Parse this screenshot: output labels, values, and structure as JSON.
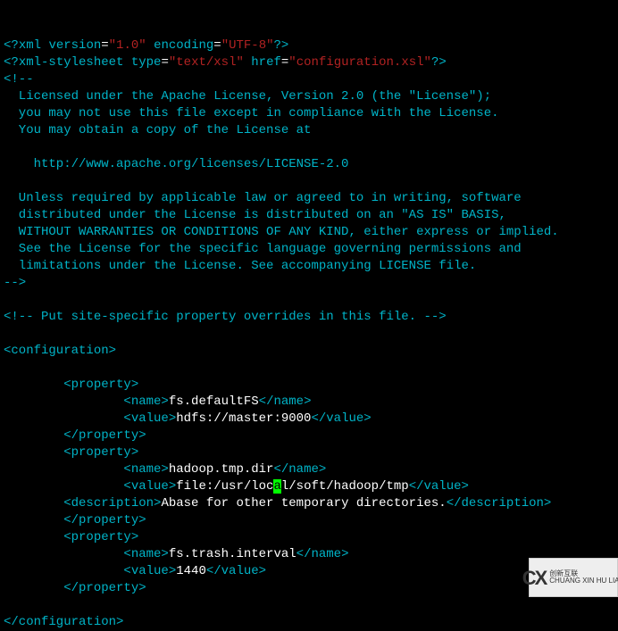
{
  "decl": {
    "pi": "xml",
    "vAttr": "version",
    "vVal": "\"1.0\"",
    "eAttr": "encoding",
    "eVal": "\"UTF-8\""
  },
  "ss": {
    "pi": "xml-stylesheet",
    "tAttr": "type",
    "tVal": "\"text/xsl\"",
    "hAttr": "href",
    "hVal": "\"configuration.xsl\""
  },
  "license": [
    "<!--",
    "  Licensed under the Apache License, Version 2.0 (the \"License\");",
    "  you may not use this file except in compliance with the License.",
    "  You may obtain a copy of the License at",
    "",
    "    http://www.apache.org/licenses/LICENSE-2.0",
    "",
    "  Unless required by applicable law or agreed to in writing, software",
    "  distributed under the License is distributed on an \"AS IS\" BASIS,",
    "  WITHOUT WARRANTIES OR CONDITIONS OF ANY KIND, either express or implied.",
    "  See the License for the specific language governing permissions and",
    "  limitations under the License. See accompanying LICENSE file.",
    "-->"
  ],
  "siteComment": "<!-- Put site-specific property overrides in this file. -->",
  "tags": {
    "confOpen": "<configuration>",
    "confClose": "</configuration>",
    "propOpen": "<property>",
    "propClose": "</property>",
    "nameOpen": "<name>",
    "nameClose": "</name>",
    "valueOpen": "<value>",
    "valueClose": "</value>",
    "descOpen": "<description>",
    "descClose": "</description>"
  },
  "p1": {
    "name": "fs.defaultFS",
    "value": "hdfs://master:9000"
  },
  "p2": {
    "name": "hadoop.tmp.dir",
    "valuePre": "file:/usr/loc",
    "cursor": "a",
    "valuePost": "l/soft/hadoop/tmp",
    "desc": "Abase for other temporary directories."
  },
  "p3": {
    "name": "fs.trash.interval",
    "value": "1440"
  },
  "watermark": {
    "left": "CX",
    "r1": "创新互联",
    "r2": "CHUANG XIN HU LIAN"
  }
}
